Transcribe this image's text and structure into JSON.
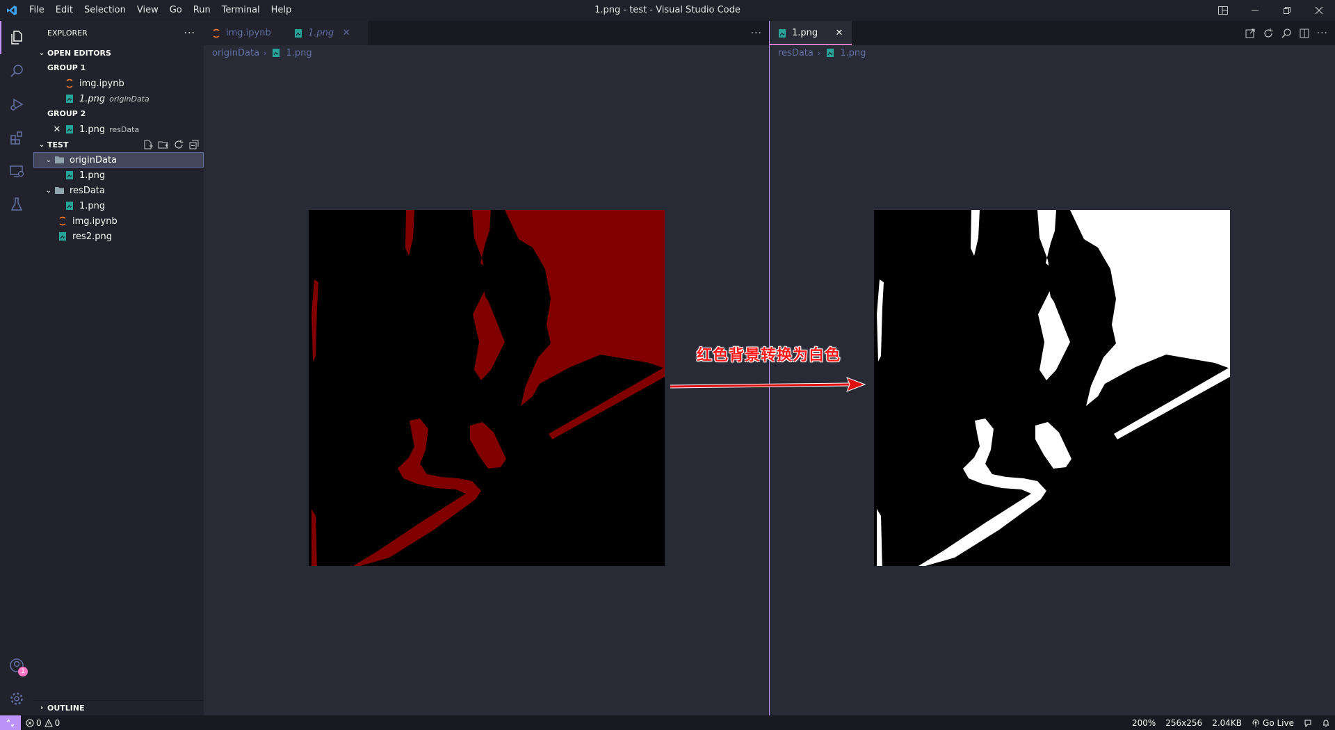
{
  "window": {
    "title": "1.png - test - Visual Studio Code",
    "menu": [
      "File",
      "Edit",
      "Selection",
      "View",
      "Go",
      "Run",
      "Terminal",
      "Help"
    ]
  },
  "sidebar": {
    "header": "EXPLORER",
    "open_editors_label": "OPEN EDITORS",
    "group1_label": "GROUP 1",
    "group2_label": "GROUP 2",
    "group1_items": [
      {
        "name": "img.ipynb",
        "desc": ""
      },
      {
        "name": "1.png",
        "desc": "originData"
      }
    ],
    "group2_items": [
      {
        "name": "1.png",
        "desc": "resData"
      }
    ],
    "folder_label": "TEST",
    "tree": {
      "origin_folder": "originData",
      "origin_file": "1.png",
      "res_folder": "resData",
      "res_file": "1.png",
      "notebook": "img.ipynb",
      "res2": "res2.png"
    },
    "outline_label": "OUTLINE"
  },
  "activity": {
    "accounts_badge": "1"
  },
  "left_editor": {
    "tabs": [
      {
        "label": "img.ipynb"
      },
      {
        "label": "1.png"
      }
    ],
    "breadcrumb": [
      "originData",
      "1.png"
    ]
  },
  "right_editor": {
    "tab": "1.png",
    "breadcrumb": [
      "resData",
      "1.png"
    ]
  },
  "annotation": {
    "text": "红色背景转换为白色"
  },
  "statusbar": {
    "errors": "0",
    "warnings": "0",
    "zoom": "200%",
    "dimensions": "256x256",
    "size": "2.04KB",
    "go_live": "Go Live"
  },
  "colors": {
    "accent": "#bd93f9",
    "tab_border": "#ff79c6",
    "mask_red": "#800000",
    "annotation_red": "#ff1a1a"
  }
}
